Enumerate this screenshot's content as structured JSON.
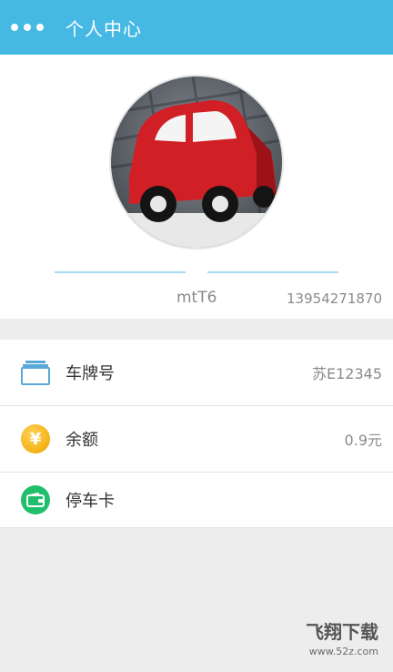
{
  "header": {
    "title": "个人中心",
    "menu_icon": "more-dots-icon"
  },
  "profile": {
    "avatar_description_icon": "red-toy-car-avatar",
    "username": "mtT6",
    "phone": "13954271870"
  },
  "list": {
    "items": [
      {
        "label": "车牌号",
        "value": "苏E12345",
        "icon": "card-stack-icon"
      },
      {
        "label": "余额",
        "value": "0.9元",
        "icon": "yen-coin-icon"
      },
      {
        "label": "停车卡",
        "value": "",
        "icon": "wallet-icon"
      }
    ]
  },
  "watermark": {
    "brand": "飞翔下载",
    "url": "www.52z.com"
  },
  "colors": {
    "header_bg": "#45b9e3",
    "coin": "#f4b115",
    "wallet": "#1fbf6b",
    "divider": "#a8d9ef"
  }
}
